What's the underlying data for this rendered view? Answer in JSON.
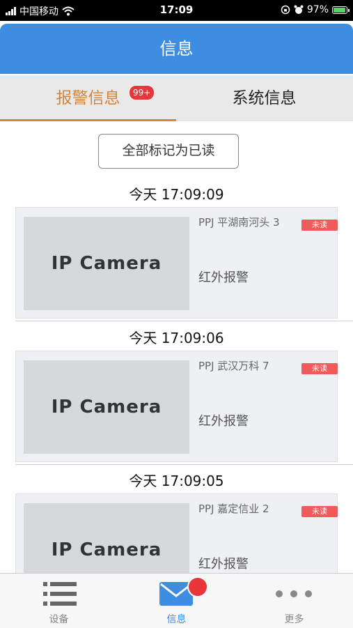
{
  "status": {
    "carrier": "中国移动",
    "time": "17:09",
    "battery": "97%",
    "battery_level": 0.97
  },
  "header": {
    "title": "信息"
  },
  "tabs": [
    {
      "label": "报警信息",
      "badge": "99+",
      "active": true
    },
    {
      "label": "系统信息",
      "active": false
    }
  ],
  "mark_all_label": "全部标记为已读",
  "alarms": [
    {
      "time": "今天 17:09:09",
      "thumb_text": "IP Camera",
      "device": "PPJ 平湖南河头 3",
      "unread": "未读",
      "type": "红外报警"
    },
    {
      "time": "今天 17:09:06",
      "thumb_text": "IP Camera",
      "device": "PPJ 武汉万科 7",
      "unread": "未读",
      "type": "红外报警"
    },
    {
      "time": "今天 17:09:05",
      "thumb_text": "IP Camera",
      "device": "PPJ 嘉定信业 2",
      "unread": "未读",
      "type": "红外报警"
    }
  ],
  "nav": [
    {
      "label": "设备",
      "icon": "list-icon"
    },
    {
      "label": "信息",
      "icon": "mail-icon"
    },
    {
      "label": "更多",
      "icon": "more-dots-icon"
    }
  ],
  "colors": {
    "primary": "#3d8ee0",
    "accent": "#d4843a",
    "badge": "#e8363a"
  }
}
